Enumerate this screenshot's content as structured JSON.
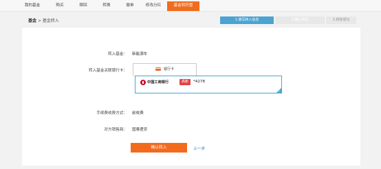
{
  "nav": {
    "tabs": [
      {
        "label": "我的基金"
      },
      {
        "label": "购买"
      },
      {
        "label": "赎回"
      },
      {
        "label": "转换"
      },
      {
        "label": "撤单"
      },
      {
        "label": "修改分红"
      },
      {
        "label": "基金转托管",
        "active": true
      }
    ]
  },
  "breadcrumb": {
    "home": "基金",
    "separator": ">",
    "current": "基金转入"
  },
  "steps": [
    {
      "label": "1.填写转入信息",
      "active": true
    },
    {
      "label": "2.确认信息"
    },
    {
      "label": "3.转账成功"
    }
  ],
  "form": {
    "fund_label": "转入基金：",
    "fund_value": "新能源车",
    "card_label": "转入基金关联银行卡：",
    "card_tab_label": "银行卡",
    "bank_name": "中国工商银行",
    "bank_badge": "高新",
    "card_tail": "*4278",
    "fee_label": "手续费收费方式：",
    "fee_value": "前收费",
    "seller_label": "对方销售商：",
    "seller_value": "国泰君安"
  },
  "actions": {
    "confirm": "确认转入",
    "prev": "上一步"
  },
  "colors": {
    "accent": "#f26b1d",
    "step_active": "#4aa3d3",
    "link": "#2a7ab8"
  }
}
